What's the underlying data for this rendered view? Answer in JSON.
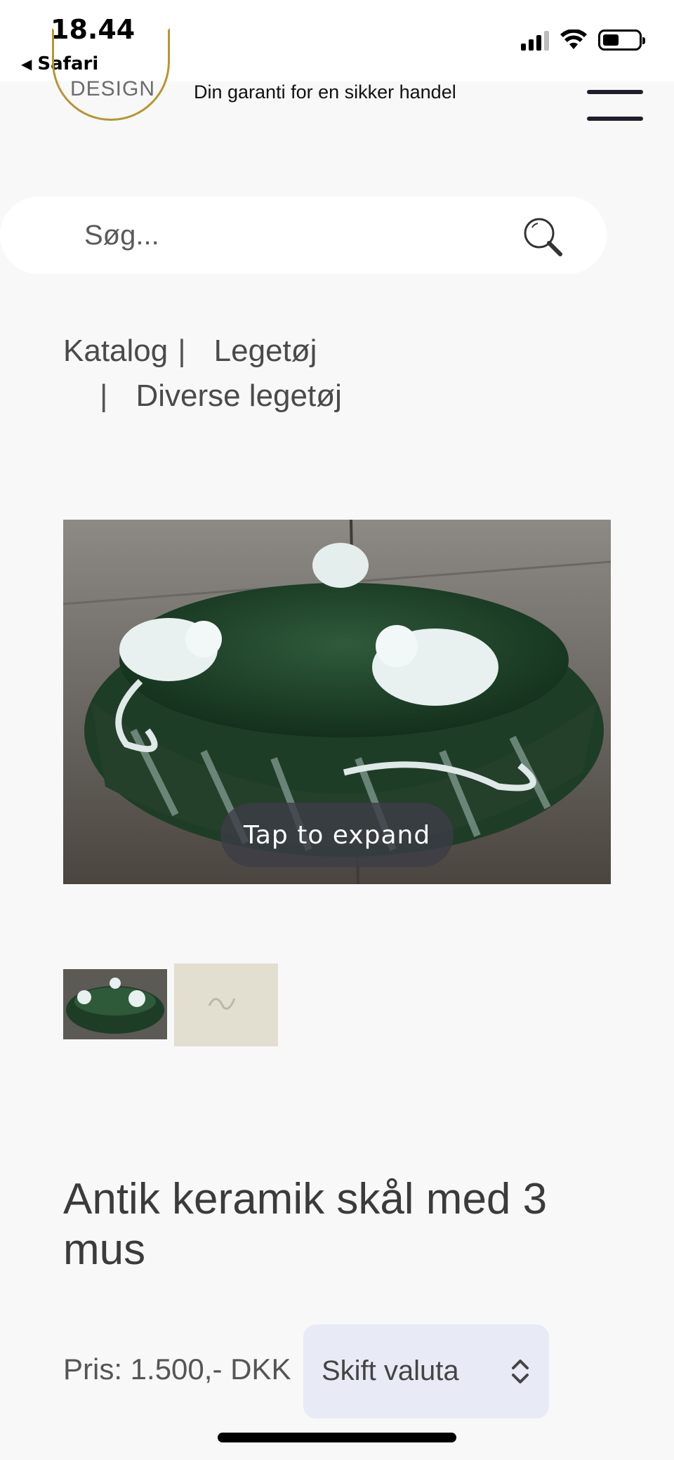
{
  "status_bar": {
    "time": "18.44",
    "back_app": "Safari",
    "back_icon": "triangle-left-icon",
    "icons": [
      "cellular-signal-icon",
      "wifi-icon",
      "battery-icon"
    ]
  },
  "header": {
    "logo_text": "DESIGN",
    "tagline": "Din garanti for en sikker handel",
    "menu_icon": "hamburger-menu-icon"
  },
  "search": {
    "placeholder": "Søg...",
    "icon": "search-icon"
  },
  "breadcrumb": {
    "items": [
      "Katalog",
      "Legetøj",
      "Diverse legetøj"
    ],
    "separator": "|"
  },
  "gallery": {
    "expand_label": "Tap to expand",
    "thumbnail_count": 2
  },
  "product": {
    "title": "Antik keramik skål med 3 mus",
    "price": "Pris: 1.500,- DKK"
  },
  "currency": {
    "select_label": "Skift valuta",
    "icon": "chevron-up-down-icon"
  },
  "colors": {
    "page_background": "#f8f8f9",
    "logo_gold": "#b8962e",
    "select_background": "#e8ebf6",
    "text_dark": "#3b3b3b"
  }
}
